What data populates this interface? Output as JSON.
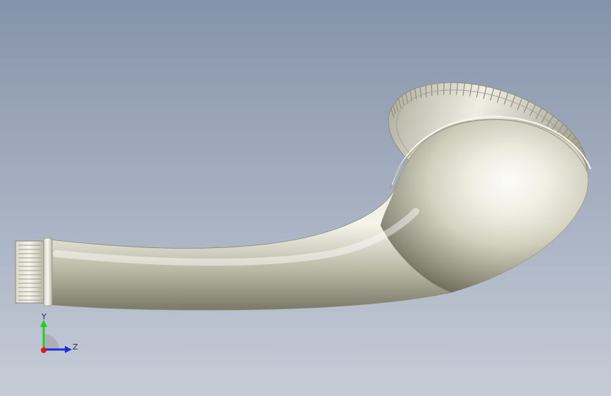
{
  "viewport": {
    "background_top": "#8795ab",
    "background_bottom": "#c4cad5",
    "model_color": "#c9c8b2",
    "model_highlight": "#fbfbf6",
    "model_shadow": "#6e6d5c",
    "edge_color": "#9c9b8a"
  },
  "triad": {
    "y_label": "Y",
    "z_label": "Z",
    "y_color": "#1fd01f",
    "z_color": "#1a2fd8",
    "x_color": "#e01a1a"
  }
}
